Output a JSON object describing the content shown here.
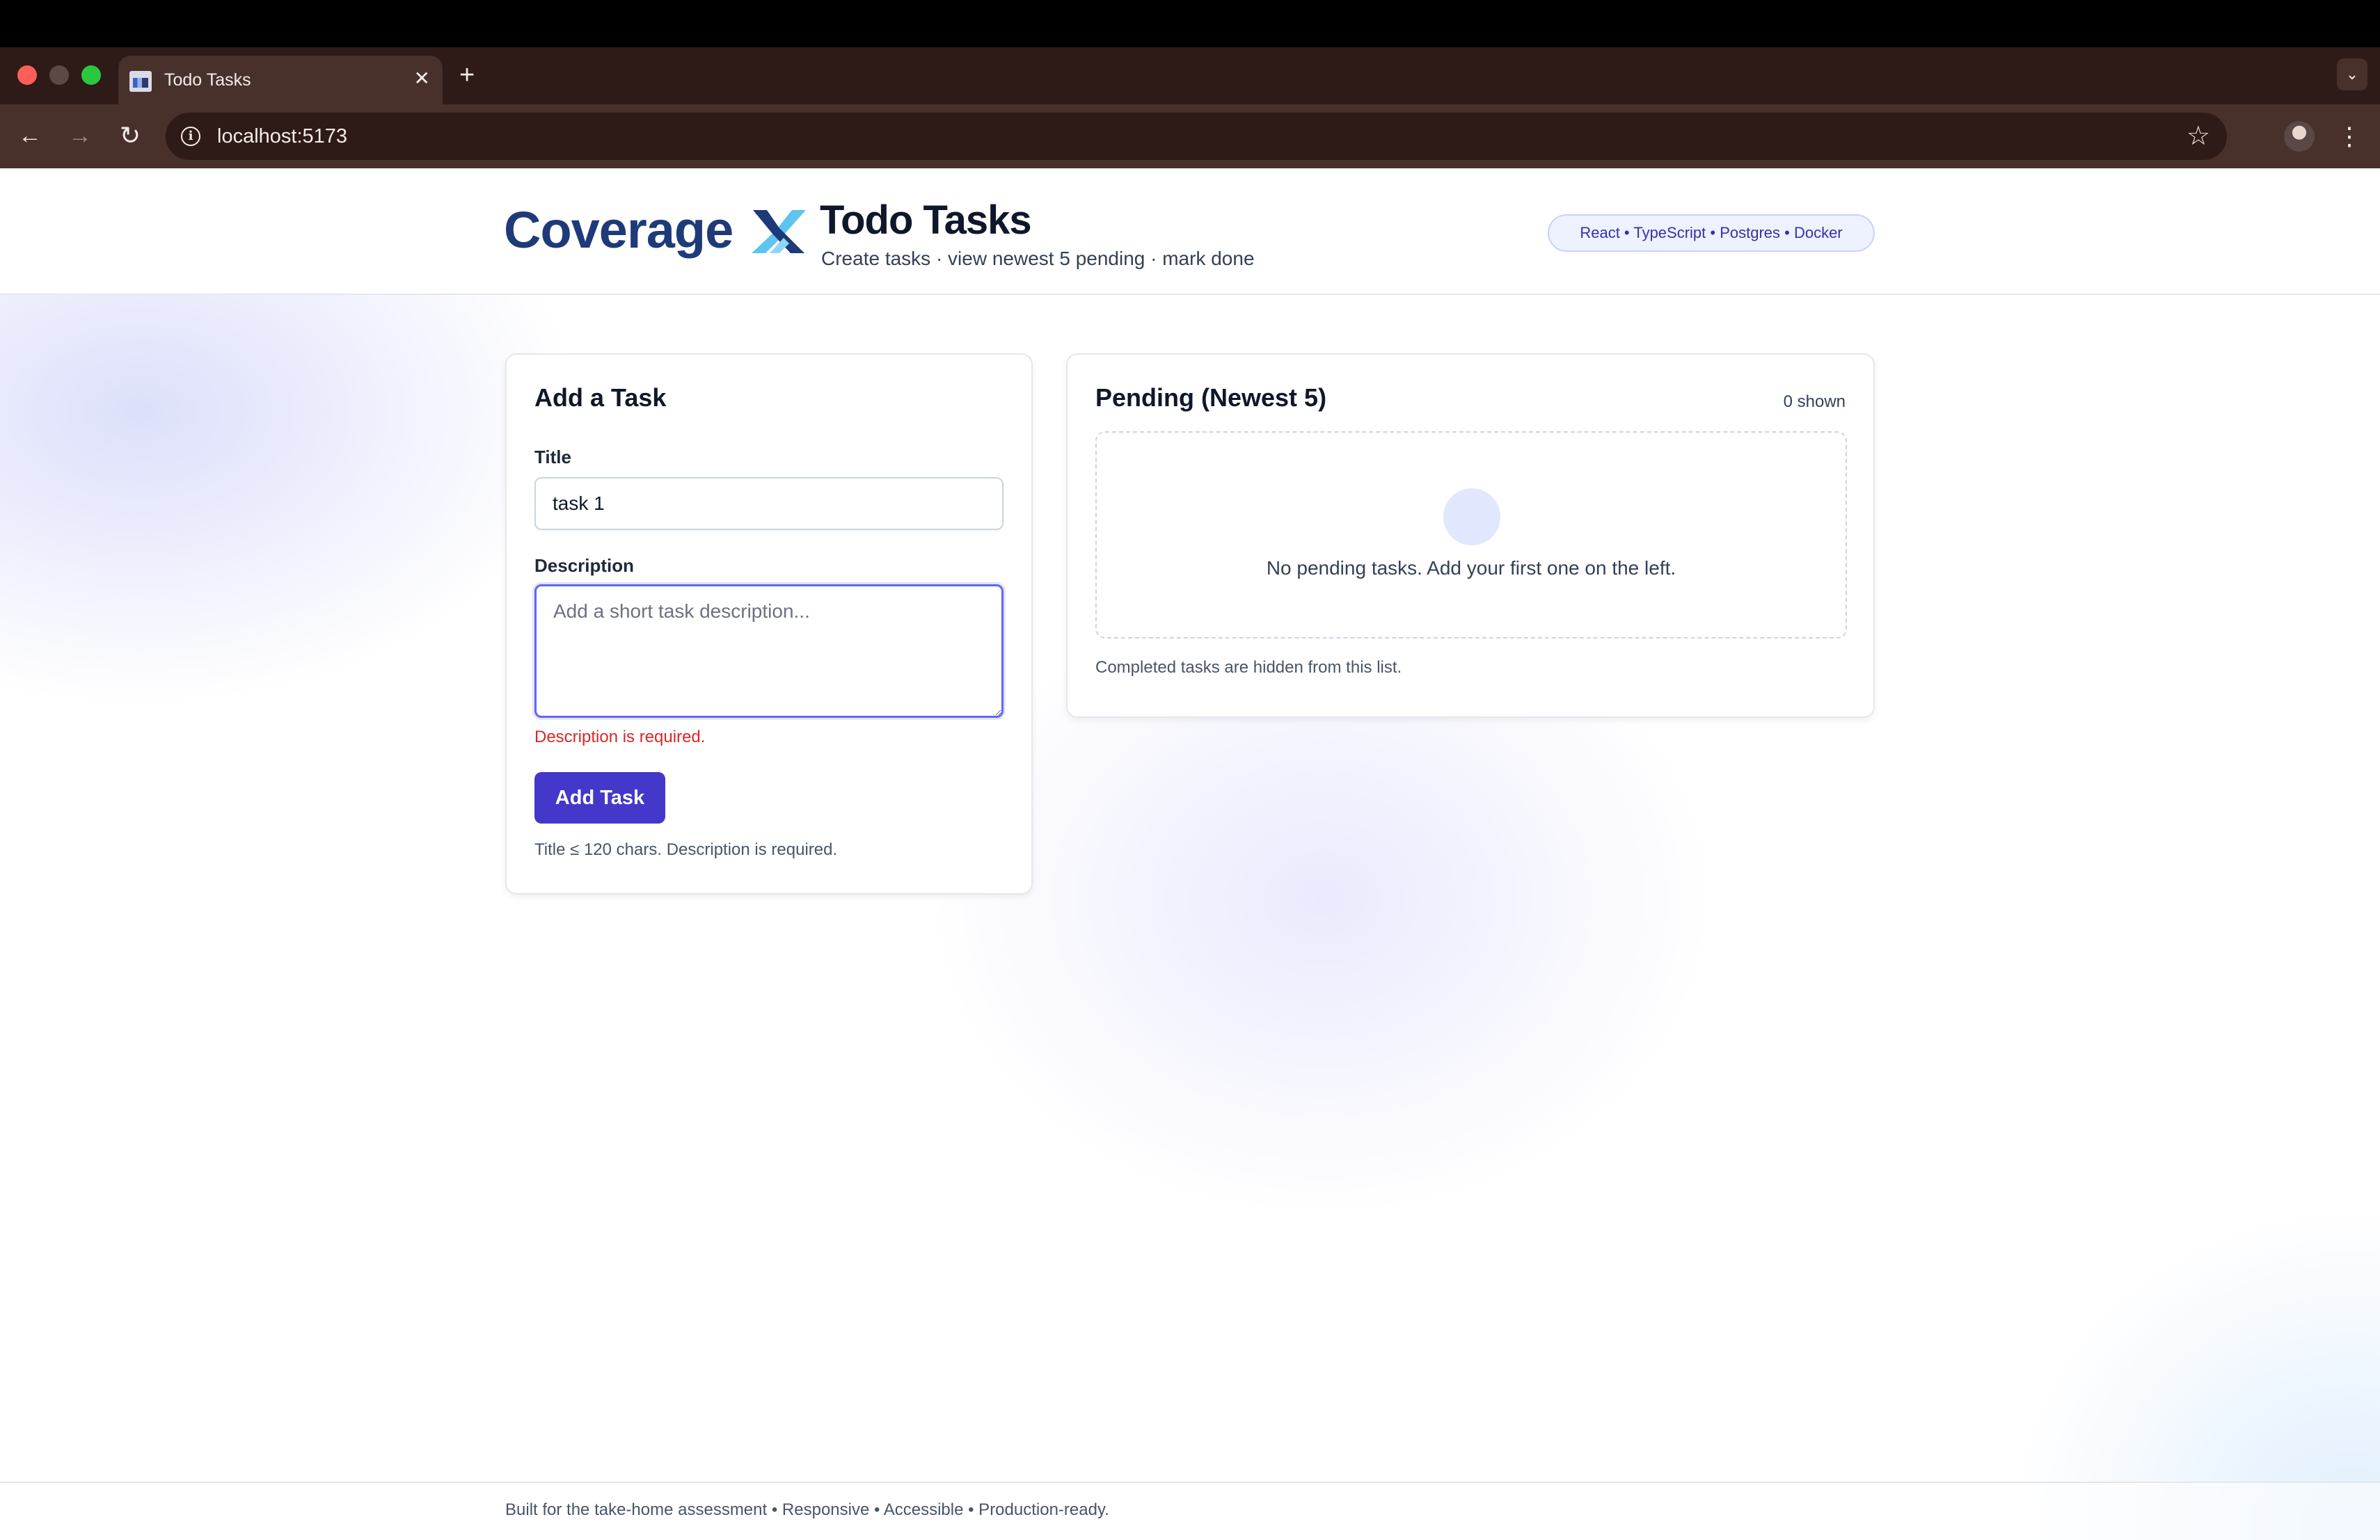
{
  "browser": {
    "tab_title": "Todo Tasks",
    "tab_close": "✕",
    "new_tab": "+",
    "tab_menu": "⌄",
    "url": "localhost:5173",
    "nav_back": "←",
    "nav_forward": "→",
    "nav_reload": "↻",
    "info": "i",
    "star": "☆",
    "menu": "⋮"
  },
  "header": {
    "logo_text": "Coverage",
    "title": "Todo Tasks",
    "subtitle": "Create tasks · view newest 5 pending · mark done",
    "tech_badge": "React • TypeScript • Postgres • Docker"
  },
  "add_card": {
    "title": "Add a Task",
    "title_label": "Title",
    "title_value": "task 1",
    "description_label": "Description",
    "description_placeholder": "Add a short task description...",
    "error": "Description is required.",
    "button": "Add Task",
    "hint": "Title ≤ 120 chars. Description is required."
  },
  "pending_card": {
    "title": "Pending (Newest 5)",
    "count": "0 shown",
    "empty_text": "No pending tasks. Add your first one on the left.",
    "footnote": "Completed tasks are hidden from this list."
  },
  "footer": {
    "text": "Built for the take-home assessment • Responsive • Accessible • Production-ready."
  },
  "colors": {
    "primary": "#4338ca",
    "focus_ring": "#6366f1",
    "error": "#dc2626",
    "logo_navy": "#1f3a78",
    "logo_x_light": "#5ec4f0",
    "chrome_dark": "#2e1a16"
  }
}
